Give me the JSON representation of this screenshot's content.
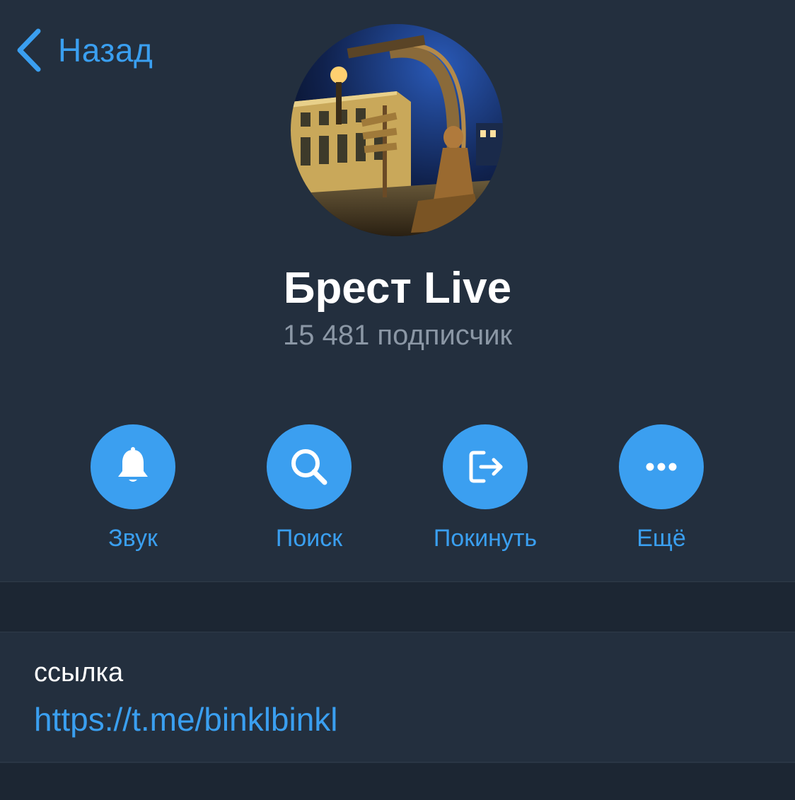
{
  "header": {
    "back_label": "Назад"
  },
  "channel": {
    "title": "Брест Live",
    "subscribers": "15 481 подписчик"
  },
  "actions": [
    {
      "label": "Звук",
      "icon": "bell-icon"
    },
    {
      "label": "Поиск",
      "icon": "search-icon"
    },
    {
      "label": "Покинуть",
      "icon": "leave-icon"
    },
    {
      "label": "Ещё",
      "icon": "more-icon"
    }
  ],
  "info": {
    "label": "ссылка",
    "link": "https://t.me/binklbinkl"
  },
  "colors": {
    "background": "#232f3e",
    "accent": "#3b9ff0",
    "muted": "#8b97a5",
    "band": "#1c2633"
  }
}
